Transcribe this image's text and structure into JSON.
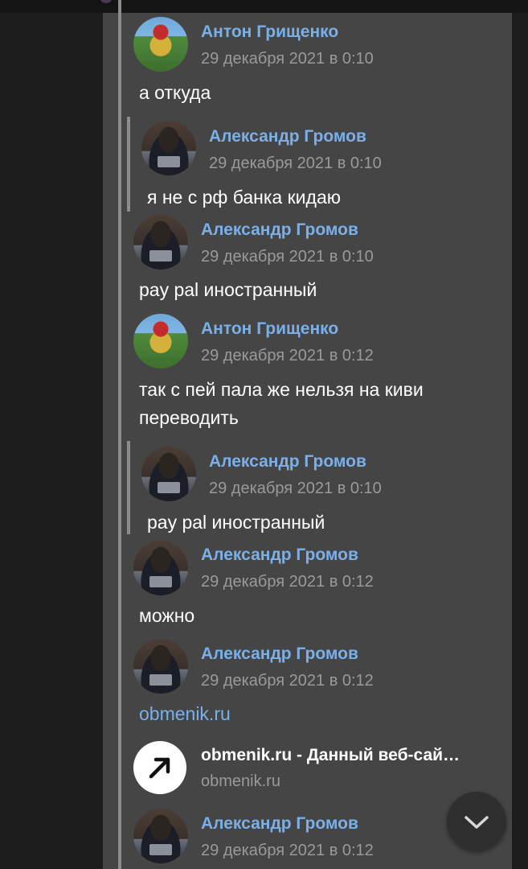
{
  "messages": [
    {
      "author": "Антон Грищенко",
      "time": "29 декабря 2021 в 0:10",
      "text": "а откуда"
    },
    {
      "author": "Александр Громов",
      "time": "29 декабря 2021 в 0:10",
      "text": "я не с рф банка кидаю"
    },
    {
      "author": "Александр Громов",
      "time": "29 декабря 2021 в 0:10",
      "text": "pay pal иностранный"
    },
    {
      "author": "Антон Грищенко",
      "time": "29 декабря 2021 в 0:12",
      "text_line1": "так с пей пала же нельзя на киви",
      "text_line2": "переводить"
    },
    {
      "author": "Александр Громов",
      "time": "29 декабря 2021 в 0:10",
      "text": "pay pal иностранный"
    },
    {
      "author": "Александр Громов",
      "time": "29 декабря 2021 в 0:12",
      "text": "можно"
    },
    {
      "author": "Александр Громов",
      "time": "29 декабря 2021 в 0:12",
      "link": "obmenik.ru"
    },
    {
      "author": "Александр Громов",
      "time": "29 декабря 2021 в 0:12"
    }
  ],
  "link_preview": {
    "title": "obmenik.ru - Данный веб-сай…",
    "domain": "obmenik.ru",
    "icon": "external-link-arrow-icon"
  },
  "scroll_button": {
    "icon": "chevron-down-icon"
  },
  "colors": {
    "panel": "#454545",
    "name": "#7ab0ea",
    "time": "#9a9a9a",
    "text": "#ffffff"
  }
}
